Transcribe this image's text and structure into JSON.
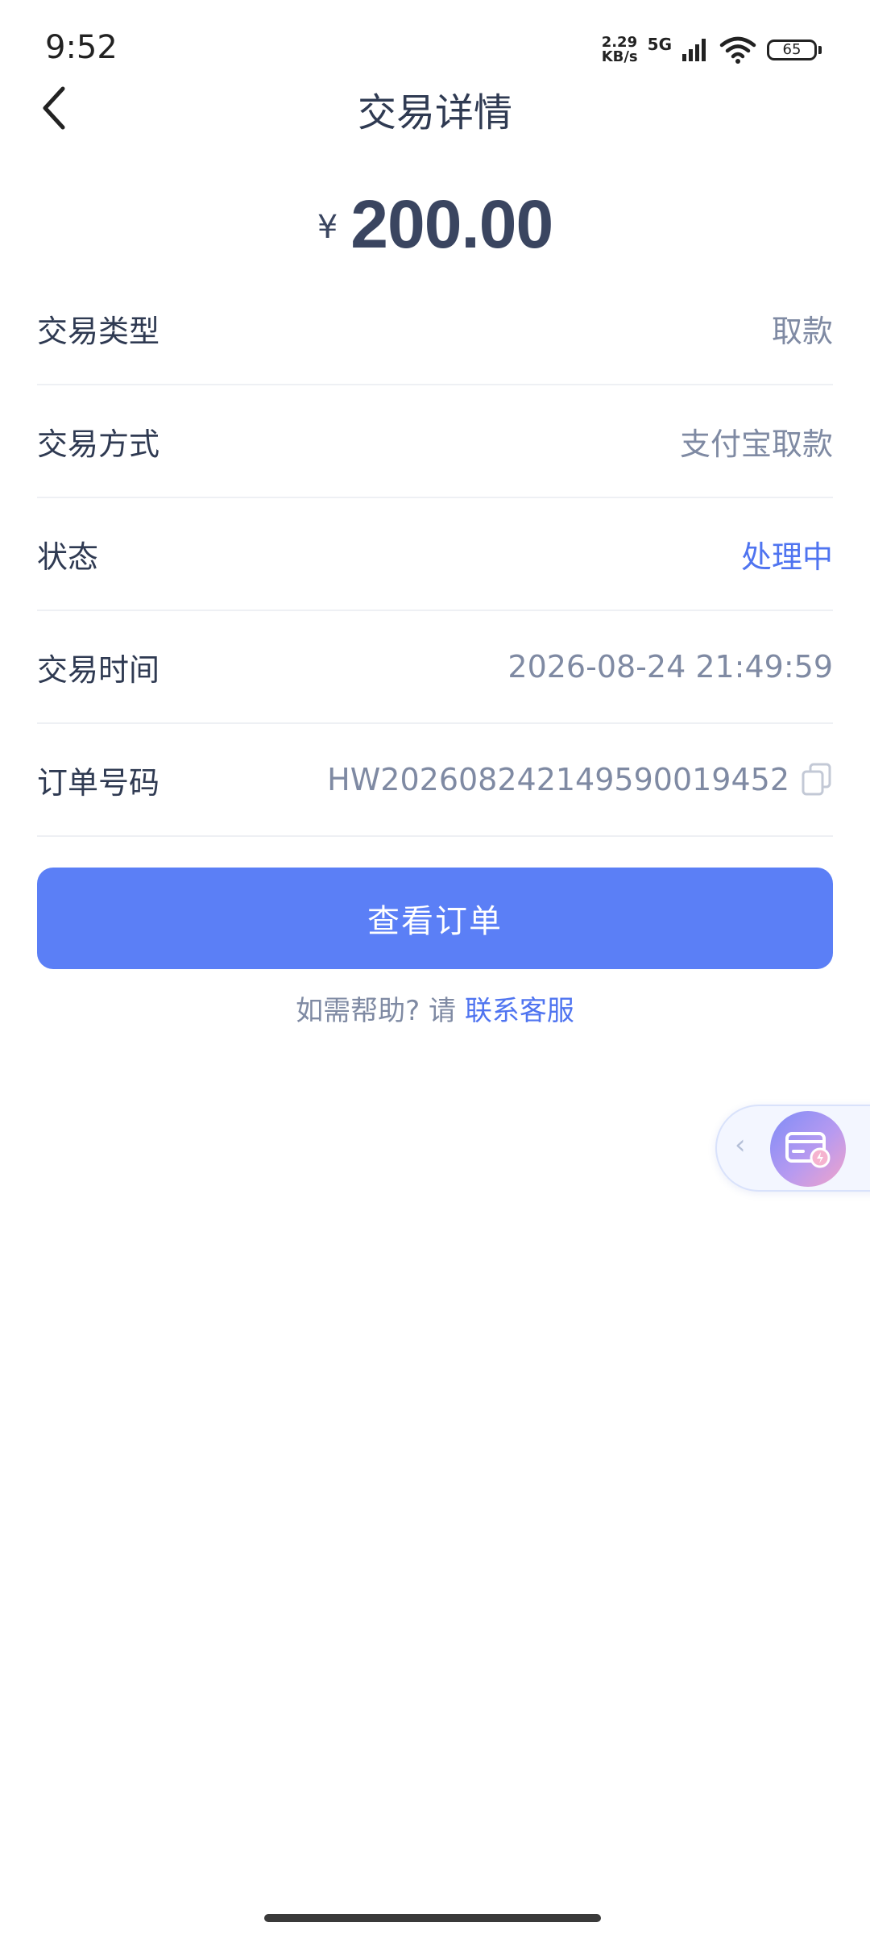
{
  "status_bar": {
    "time": "9:52",
    "net_speed_value": "2.29",
    "net_speed_unit": "KB/s",
    "net_type": "5G",
    "battery": "65"
  },
  "header": {
    "title": "交易详情"
  },
  "amount": {
    "symbol": "¥",
    "value": "200.00"
  },
  "details": [
    {
      "label": "交易类型",
      "value": "取款"
    },
    {
      "label": "交易方式",
      "value": "支付宝取款"
    },
    {
      "label": "状态",
      "value": "处理中"
    },
    {
      "label": "交易时间",
      "value": "2026-08-24 21:49:59"
    },
    {
      "label": "订单号码",
      "value": "HW20260824214959001945​2"
    }
  ],
  "button": {
    "view_order": "查看订单"
  },
  "help": {
    "prefix": "如需帮助? 请",
    "link": "联系客服"
  },
  "float_widget": {
    "chevron": "‹"
  },
  "colors": {
    "accent": "#5b7ff6",
    "status": "#4f74f0",
    "muted": "#7f8aa3",
    "text": "#2f3a52"
  }
}
